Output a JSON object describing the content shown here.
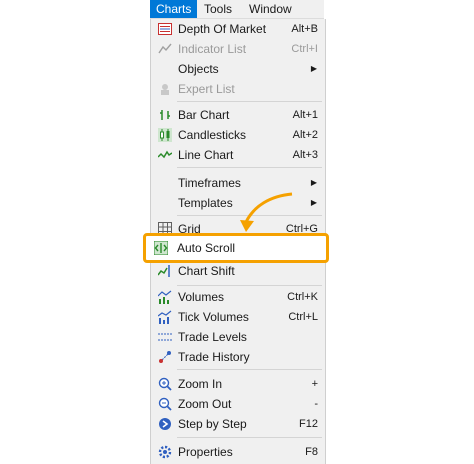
{
  "menubar": {
    "items": [
      "Charts",
      "Tools",
      "Window"
    ]
  },
  "menu": {
    "items": [
      {
        "label": "Depth Of Market",
        "shortcut": "Alt+B",
        "icon": "depth-of-market-icon"
      },
      {
        "label": "Indicator List",
        "shortcut": "Ctrl+I",
        "icon": "indicator-list-icon",
        "disabled": true
      },
      {
        "label": "Objects",
        "submenu": true
      },
      {
        "label": "Expert List",
        "icon": "expert-list-icon",
        "disabled": true
      },
      {
        "label": "Bar Chart",
        "shortcut": "Alt+1",
        "icon": "bar-chart-icon"
      },
      {
        "label": "Candlesticks",
        "shortcut": "Alt+2",
        "icon": "candlesticks-icon"
      },
      {
        "label": "Line Chart",
        "shortcut": "Alt+3",
        "icon": "line-chart-icon"
      },
      {
        "label": "Timeframes",
        "submenu": true
      },
      {
        "label": "Templates",
        "submenu": true
      },
      {
        "label": "Grid",
        "shortcut": "Ctrl+G",
        "icon": "grid-icon"
      },
      {
        "label": "Auto Scroll",
        "icon": "auto-scroll-icon"
      },
      {
        "label": "Chart Shift",
        "icon": "chart-shift-icon"
      },
      {
        "label": "Volumes",
        "shortcut": "Ctrl+K",
        "icon": "volumes-icon"
      },
      {
        "label": "Tick Volumes",
        "shortcut": "Ctrl+L",
        "icon": "tick-volumes-icon"
      },
      {
        "label": "Trade Levels",
        "icon": "trade-levels-icon"
      },
      {
        "label": "Trade History",
        "icon": "trade-history-icon"
      },
      {
        "label": "Zoom In",
        "shortcut": "+",
        "icon": "zoom-in-icon"
      },
      {
        "label": "Zoom Out",
        "shortcut": "-",
        "icon": "zoom-out-icon"
      },
      {
        "label": "Step by Step",
        "shortcut": "F12",
        "icon": "step-by-step-icon"
      },
      {
        "label": "Properties",
        "shortcut": "F8",
        "icon": "properties-icon"
      }
    ]
  },
  "colors": {
    "highlight_border": "#f5a100",
    "menubar_active": "#0078d7"
  }
}
